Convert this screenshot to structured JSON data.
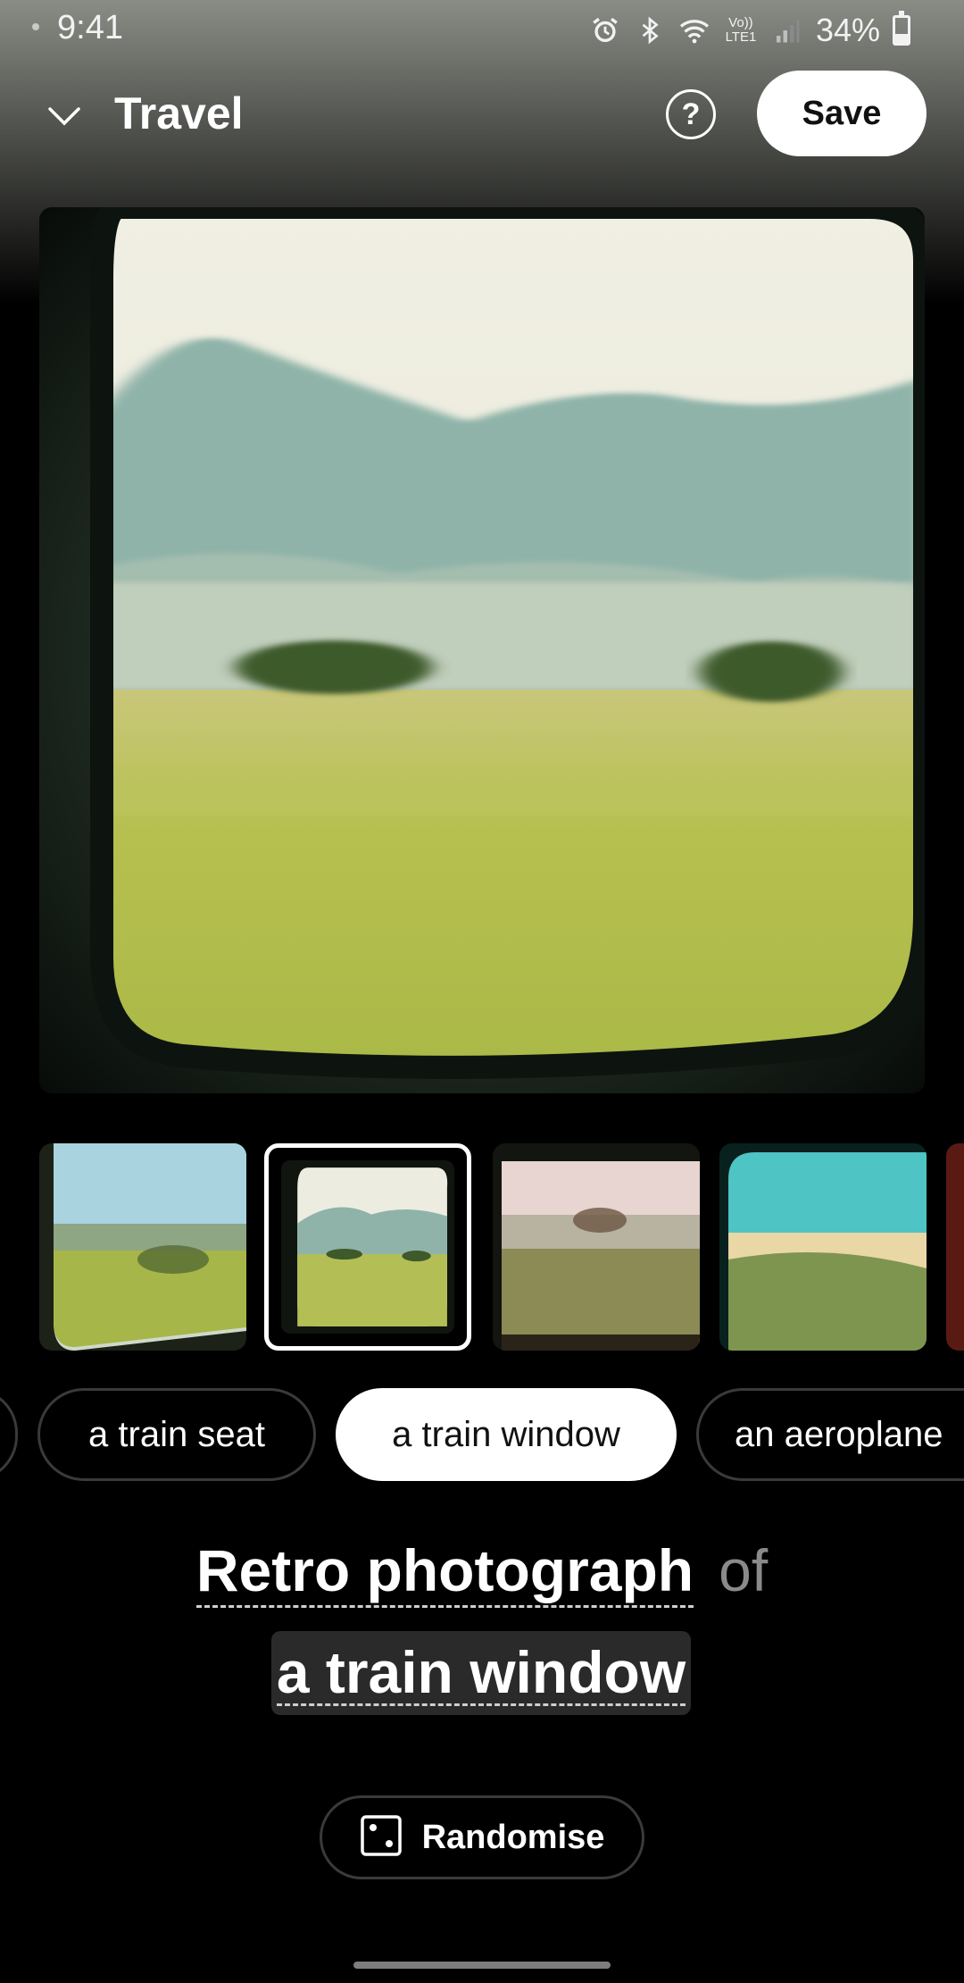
{
  "status_bar": {
    "time": "9:41",
    "battery_percent": "34%",
    "battery_level": 0.34,
    "network_label": "Vo)) LTE1",
    "icons": [
      "alarm-icon",
      "bluetooth-icon",
      "wifi-icon",
      "signal-icon",
      "battery-icon"
    ]
  },
  "header": {
    "title": "Travel",
    "help_label": "?",
    "save_label": "Save"
  },
  "main_image": {
    "description_icon": "train-window-landscape-image"
  },
  "thumbnails": [
    {
      "id": "thumb-1",
      "selected": false
    },
    {
      "id": "thumb-2",
      "selected": true
    },
    {
      "id": "thumb-3",
      "selected": false
    },
    {
      "id": "thumb-4",
      "selected": false
    }
  ],
  "chips": [
    {
      "label": "a train seat",
      "active": false
    },
    {
      "label": "a train window",
      "active": true
    },
    {
      "label": "an aeroplane",
      "active": false
    }
  ],
  "prompt": {
    "style": "Retro photograph",
    "connector": "of",
    "subject": "a train window"
  },
  "randomise": {
    "label": "Randomise",
    "icon": "dice-icon"
  },
  "colors": {
    "background": "#000000",
    "chip_border": "#3a3a3a",
    "subject_highlight": "#2a2a2a",
    "connector_gray": "#8a8a8a"
  }
}
